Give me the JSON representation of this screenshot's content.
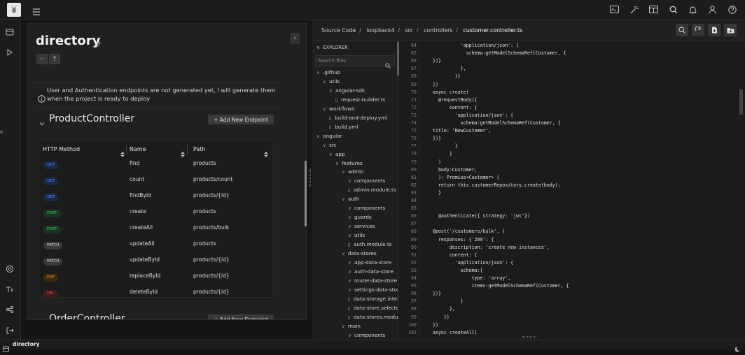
{
  "topbar": {
    "icons": [
      "terminal-icon",
      "magic-wand-icon",
      "layout-icon",
      "search-icon",
      "bell-icon",
      "user-icon",
      "help-icon"
    ]
  },
  "leftrail": {
    "icons": [
      "database-icon",
      "play-icon",
      "settings-icon",
      "text-size-icon",
      "share-icon",
      "logout-icon"
    ]
  },
  "panel": {
    "title": "directory",
    "more_label": "···",
    "up_label": "↑",
    "collapse_label": "‹",
    "info": "User and Authentication endpoints are not generated yet, I will generate them when the project is ready to deploy"
  },
  "product_controller": {
    "title": "ProductController",
    "add_label": "+ Add New Endpoint",
    "columns": [
      "HTTP Method",
      "Name",
      "Path"
    ],
    "rows": [
      {
        "method": "GET",
        "name": "find",
        "path": "products"
      },
      {
        "method": "GET",
        "name": "count",
        "path": "products/count"
      },
      {
        "method": "GET",
        "name": "findById",
        "path": "products/{id}"
      },
      {
        "method": "POST",
        "name": "create",
        "path": "products"
      },
      {
        "method": "POST",
        "name": "createAll",
        "path": "products/bulk"
      },
      {
        "method": "PATCH",
        "name": "updateAll",
        "path": "products"
      },
      {
        "method": "PATCH",
        "name": "updateById",
        "path": "products/{id}"
      },
      {
        "method": "PUT",
        "name": "replaceById",
        "path": "products/{id}"
      },
      {
        "method": "DEL",
        "name": "deleteById",
        "path": "products/{id}"
      }
    ]
  },
  "order_controller": {
    "title": "OrderController",
    "add_label": "+ Add New Endpoint"
  },
  "method_colors": {
    "GET": {
      "bg": "#1b2a45",
      "fg": "#5b8cff"
    },
    "POST": {
      "bg": "#1b3524",
      "fg": "#4fbf6b"
    },
    "PATCH": {
      "bg": "#3a3a3a",
      "fg": "#d8d8d8"
    },
    "PUT": {
      "bg": "#3f2b12",
      "fg": "#e89a3c"
    },
    "DEL": {
      "bg": "#3f1c1c",
      "fg": "#e05858"
    }
  },
  "editor": {
    "breadcrumb": [
      "Source Code",
      "loopback4",
      "src",
      "controllers",
      "customer.controller.ts"
    ],
    "actions": [
      "search-icon",
      "refresh-icon",
      "new-file-icon",
      "new-folder-icon"
    ],
    "explorer_title": "EXPLORER",
    "search_placeholder": "Search files",
    "tree": [
      {
        "label": ".github",
        "depth": 0,
        "type": "folder"
      },
      {
        "label": "utils",
        "depth": 1,
        "type": "folder"
      },
      {
        "label": "angular-sdk",
        "depth": 2,
        "type": "folder"
      },
      {
        "label": "request-builder.ts",
        "depth": 3,
        "type": "file"
      },
      {
        "label": "workflows",
        "depth": 1,
        "type": "folder"
      },
      {
        "label": "build-and-deploy.yml",
        "depth": 2,
        "type": "file"
      },
      {
        "label": "build.yml",
        "depth": 2,
        "type": "file"
      },
      {
        "label": "angular",
        "depth": 0,
        "type": "folder"
      },
      {
        "label": "src",
        "depth": 1,
        "type": "folder"
      },
      {
        "label": "app",
        "depth": 2,
        "type": "folder"
      },
      {
        "label": "features",
        "depth": 3,
        "type": "folder"
      },
      {
        "label": "admin",
        "depth": 4,
        "type": "folder"
      },
      {
        "label": "components",
        "depth": 5,
        "type": "folder"
      },
      {
        "label": "admin.module.ts",
        "depth": 5,
        "type": "file"
      },
      {
        "label": "auth",
        "depth": 4,
        "type": "folder"
      },
      {
        "label": "components",
        "depth": 5,
        "type": "folder"
      },
      {
        "label": "guards",
        "depth": 5,
        "type": "folder"
      },
      {
        "label": "services",
        "depth": 5,
        "type": "folder"
      },
      {
        "label": "utils",
        "depth": 5,
        "type": "folder"
      },
      {
        "label": "auth.module.ts",
        "depth": 5,
        "type": "file"
      },
      {
        "label": "data-stores",
        "depth": 4,
        "type": "folder"
      },
      {
        "label": "app-data-store",
        "depth": 5,
        "type": "folder"
      },
      {
        "label": "auth-data-store",
        "depth": 5,
        "type": "folder"
      },
      {
        "label": "router-data-store",
        "depth": 5,
        "type": "folder"
      },
      {
        "label": "settings-data-store",
        "depth": 5,
        "type": "folder"
      },
      {
        "label": "data-storage.interfac",
        "depth": 5,
        "type": "file"
      },
      {
        "label": "data-store.selectors.",
        "depth": 5,
        "type": "file"
      },
      {
        "label": "data-stores.module.t",
        "depth": 5,
        "type": "file"
      },
      {
        "label": "main",
        "depth": 4,
        "type": "folder"
      },
      {
        "label": "components",
        "depth": 5,
        "type": "folder"
      }
    ],
    "lines": [
      {
        "n": "64",
        "text": "          'application/json': {"
      },
      {
        "n": "65",
        "text": "            schema:getModelSchemaRef(Customer, {"
      },
      {
        "n": "66",
        "text": "})}"
      },
      {
        "n": "67",
        "text": "          },"
      },
      {
        "n": "68",
        "text": "        }}"
      },
      {
        "n": "69",
        "text": "})"
      },
      {
        "n": "70",
        "text": "async create("
      },
      {
        "n": "71",
        "text": "  @requestBody({"
      },
      {
        "n": "72",
        "text": "      content: {"
      },
      {
        "n": "73",
        "text": "        'application/json': {"
      },
      {
        "n": "74",
        "text": "          schema:getModelSchemaRef(Customer, {"
      },
      {
        "n": "75",
        "text": "title: 'NewCustomer',"
      },
      {
        "n": "76",
        "text": "})}"
      },
      {
        "n": "77",
        "text": "        }"
      },
      {
        "n": "78",
        "text": "      }"
      },
      {
        "n": "79",
        "text": "  )"
      },
      {
        "n": "80",
        "text": "  body:Customer,"
      },
      {
        "n": "81",
        "text": "  ): Promise<Customer> {"
      },
      {
        "n": "82",
        "text": "  return this.customerRepository.create(body);"
      },
      {
        "n": "83",
        "text": "  }"
      },
      {
        "n": "84",
        "text": ""
      },
      {
        "n": "85",
        "text": ""
      },
      {
        "n": "86",
        "text": "  @authenticate({ strategy: 'jwt'})"
      },
      {
        "n": "87",
        "text": ""
      },
      {
        "n": "88",
        "text": "@post('/customers/bulk', {"
      },
      {
        "n": "89",
        "text": "  responses: {'200': {"
      },
      {
        "n": "90",
        "text": "      description: 'create new instances',"
      },
      {
        "n": "91",
        "text": "      content: {"
      },
      {
        "n": "92",
        "text": "        'application/json': {"
      },
      {
        "n": "93",
        "text": "          schema:{"
      },
      {
        "n": "94",
        "text": "              type: 'array',"
      },
      {
        "n": "95",
        "text": "              items:getModelSchemaRef(Customer, {"
      },
      {
        "n": "96",
        "text": "})}"
      },
      {
        "n": "97",
        "text": "          }"
      },
      {
        "n": "98",
        "text": "      },"
      },
      {
        "n": "99",
        "text": "    }}"
      },
      {
        "n": "100",
        "text": "})"
      },
      {
        "n": "101",
        "text": "async createAll("
      }
    ]
  },
  "statusbar": {
    "label": "directory"
  }
}
